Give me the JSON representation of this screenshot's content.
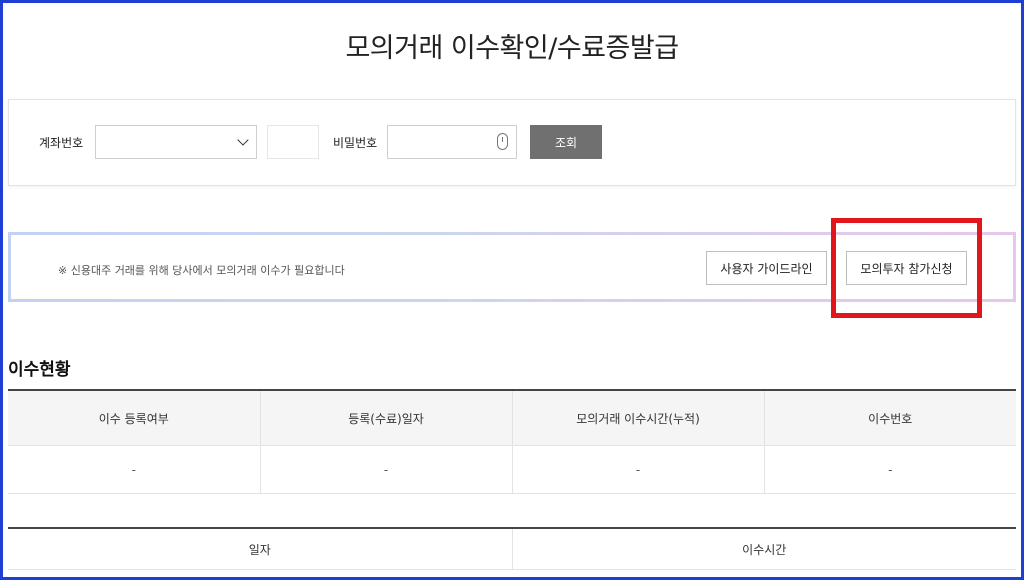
{
  "page_title": "모의거래 이수확인/수료증발급",
  "search": {
    "account_label": "계좌번호",
    "account_value": "",
    "password_label": "비밀번호",
    "password_value": "",
    "query_button": "조회"
  },
  "notice": {
    "text": "※ 신용대주 거래를 위해 당사에서 모의거래 이수가 필요합니다",
    "guide_button": "사용자 가이드라인",
    "apply_button": "모의투자 참가신청"
  },
  "status": {
    "title": "이수현황",
    "headers": [
      "이수 등록여부",
      "등록(수료)일자",
      "모의거래 이수시간(누적)",
      "이수번호"
    ],
    "values": [
      "-",
      "-",
      "-",
      "-"
    ]
  },
  "history": {
    "headers": [
      "일자",
      "이수시간"
    ]
  },
  "colors": {
    "frame": "#1e3fd6",
    "highlight": "#e0161b",
    "query_button_bg": "#707070"
  }
}
